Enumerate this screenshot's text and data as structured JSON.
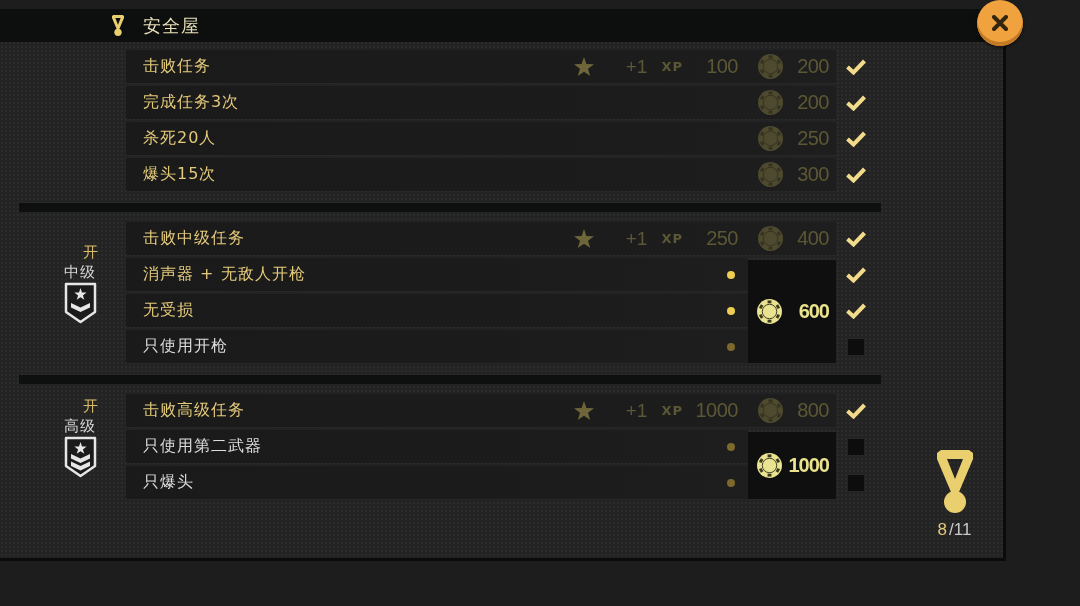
{
  "header": {
    "title": "安全屋"
  },
  "sections": [
    {
      "missions": [
        {
          "kind": "main",
          "name": "击败任务",
          "star_reward": "+1",
          "xp_label": "XP",
          "xp": "100",
          "coins": "200",
          "completed": true
        },
        {
          "kind": "coin",
          "name": "完成任务3次",
          "coins": "200",
          "completed": true
        },
        {
          "kind": "coin",
          "name": "杀死20人",
          "coins": "250",
          "completed": true
        },
        {
          "kind": "coin",
          "name": "爆头15次",
          "coins": "300",
          "completed": true
        }
      ]
    },
    {
      "rank": {
        "status": "开",
        "name": "中级",
        "kind": "single"
      },
      "missions": [
        {
          "kind": "main",
          "name": "击败中级任务",
          "star_reward": "+1",
          "xp_label": "XP",
          "xp": "250",
          "coins": "400",
          "completed": true
        },
        {
          "kind": "bonus",
          "name": "消声器 + 无敌人开枪",
          "completed": true
        },
        {
          "kind": "bonus",
          "name": "无受损",
          "completed": true
        },
        {
          "kind": "bonus",
          "name": "只使用开枪",
          "completed": false
        }
      ],
      "bonus": {
        "coins": "600"
      }
    },
    {
      "rank": {
        "status": "开",
        "name": "高级",
        "kind": "double"
      },
      "missions": [
        {
          "kind": "main",
          "name": "击败高级任务",
          "star_reward": "+1",
          "xp_label": "XP",
          "xp": "1000",
          "coins": "800",
          "completed": true
        },
        {
          "kind": "bonus",
          "name": "只使用第二武器",
          "completed": false
        },
        {
          "kind": "bonus",
          "name": "只爆头",
          "completed": false
        }
      ],
      "bonus": {
        "coins": "1000"
      }
    }
  ],
  "progress": {
    "completed": "8",
    "total": "/11"
  }
}
